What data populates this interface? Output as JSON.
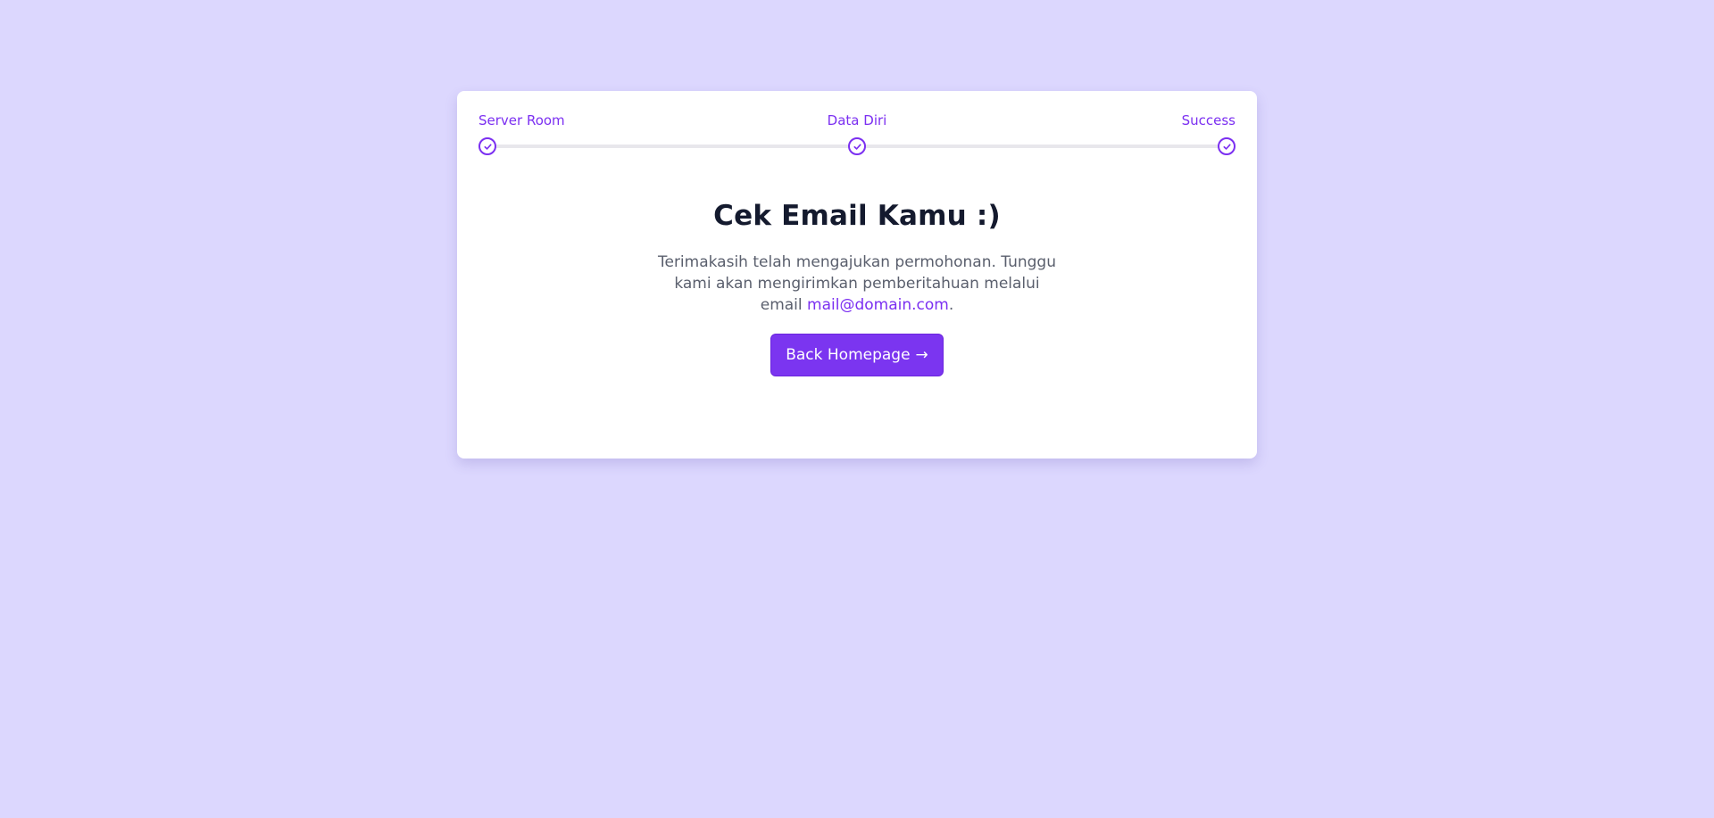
{
  "stepper": {
    "steps": [
      {
        "label": "Server Room",
        "status": "complete"
      },
      {
        "label": "Data Diri",
        "status": "complete"
      },
      {
        "label": "Success",
        "status": "complete"
      }
    ],
    "icon": "check-circle-icon"
  },
  "main": {
    "title": "Cek Email Kamu :)",
    "message_before": "Terimakasih telah mengajukan permohonan. Tunggu kami akan mengirimkan pemberitahuan melalui email ",
    "email": "mail@domain.com",
    "message_after": ".",
    "button_label": "Back Homepage",
    "button_arrow": "→"
  },
  "colors": {
    "background": "#dcd7fe",
    "accent": "#7b2ff1",
    "title": "#141a2e",
    "text": "#5a5f6d"
  }
}
